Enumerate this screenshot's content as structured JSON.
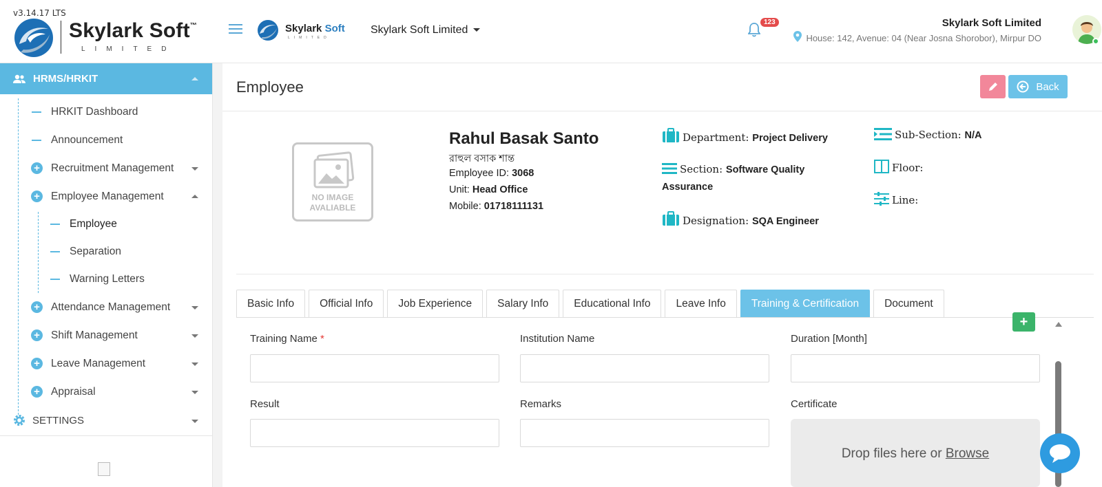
{
  "app": {
    "version": "v3.14.17 LTS",
    "brand": {
      "name": "Skylark Soft",
      "trademark": "™",
      "subtitle": "LIMITED",
      "mini_name": "Skylark",
      "mini_soft": "Soft"
    },
    "company_selector": "Skylark Soft Limited",
    "notifications": {
      "count": "123"
    },
    "user": {
      "company": "Skylark Soft Limited",
      "address": "House: 142, Avenue: 04 (Near Josna Shorobor), Mirpur DO"
    }
  },
  "sidebar": {
    "module": "HRMS/HRKIT",
    "items": [
      {
        "label": "HRKIT Dashboard"
      },
      {
        "label": "Announcement"
      },
      {
        "label": "Recruitment Management"
      },
      {
        "label": "Employee Management"
      },
      {
        "label": "Attendance Management"
      },
      {
        "label": "Shift Management"
      },
      {
        "label": "Leave Management"
      },
      {
        "label": "Appraisal"
      }
    ],
    "employee_sub": [
      {
        "label": "Employee"
      },
      {
        "label": "Separation"
      },
      {
        "label": "Warning Letters"
      }
    ],
    "settings": "SETTINGS"
  },
  "page": {
    "title": "Employee",
    "back_label": "Back"
  },
  "profile": {
    "no_image_line1": "NO IMAGE",
    "no_image_line2": "AVALIABLE",
    "name": "Rahul Basak Santo",
    "name_local": "রাহুল বসাক শান্ত",
    "employee_id_label": "Employee ID:",
    "employee_id": "3068",
    "unit_label": "Unit:",
    "unit": "Head Office",
    "mobile_label": "Mobile:",
    "mobile": "01718111131",
    "department_label": "Department:",
    "department": "Project Delivery",
    "section_label": "Section:",
    "section_line1": "Software Quality",
    "section_line2": "Assurance",
    "designation_label": "Designation:",
    "designation": "SQA Engineer",
    "subsection_label": "Sub-Section:",
    "subsection": "N/A",
    "floor_label": "Floor:",
    "line_label": "Line:"
  },
  "tabs": [
    {
      "label": "Basic Info"
    },
    {
      "label": "Official Info"
    },
    {
      "label": "Job Experience"
    },
    {
      "label": "Salary Info"
    },
    {
      "label": "Educational Info"
    },
    {
      "label": "Leave Info"
    },
    {
      "label": "Training & Certification"
    },
    {
      "label": "Document"
    }
  ],
  "form": {
    "training_name_label": "Training Name",
    "required_mark": "*",
    "institution_label": "Institution Name",
    "duration_label": "Duration [Month]",
    "result_label": "Result",
    "remarks_label": "Remarks",
    "certificate_label": "Certificate",
    "drop_text": "Drop files here or",
    "browse_text": "Browse",
    "add_label": "+"
  },
  "colors": {
    "accent": "#5bb8e1",
    "tab_active": "#6cc2e8",
    "edit_button": "#f2879a",
    "add_button": "#3bb46a",
    "badge": "#e44b4b",
    "info_icon": "#1fb7c5"
  },
  "icons": [
    "menu-icon",
    "bell-icon",
    "location-pin-icon",
    "users-icon",
    "pencil-icon",
    "back-arrow-icon",
    "briefcase-icon",
    "list-icon",
    "sub-section-icon",
    "floor-icon",
    "sliders-icon",
    "gear-icon",
    "chat-icon",
    "image-placeholder-icon"
  ]
}
